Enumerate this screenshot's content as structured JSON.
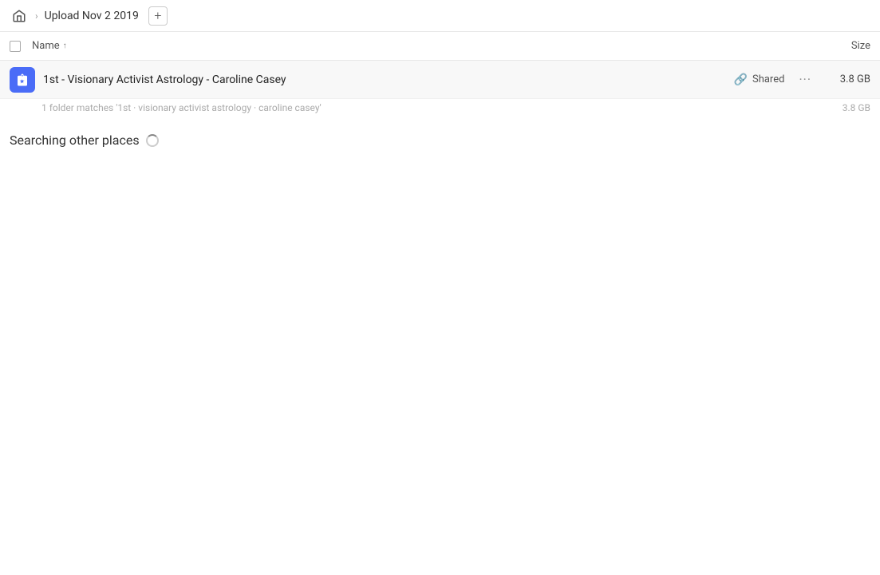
{
  "topbar": {
    "home_icon": "home",
    "breadcrumb_title": "Upload Nov 2 2019",
    "add_button_label": "+"
  },
  "columns": {
    "checkbox_label": "select-all",
    "name_label": "Name",
    "sort_direction": "↑",
    "size_label": "Size"
  },
  "file_row": {
    "icon_color": "#4a6cf7",
    "name": "1st - Visionary Activist Astrology - Caroline Casey",
    "shared_label": "Shared",
    "size": "3.8 GB",
    "more_label": "···"
  },
  "match_line": {
    "text": "1 folder matches '1st · visionary activist astrology · caroline casey'",
    "size": "3.8 GB"
  },
  "searching_section": {
    "text": "Searching other places"
  }
}
